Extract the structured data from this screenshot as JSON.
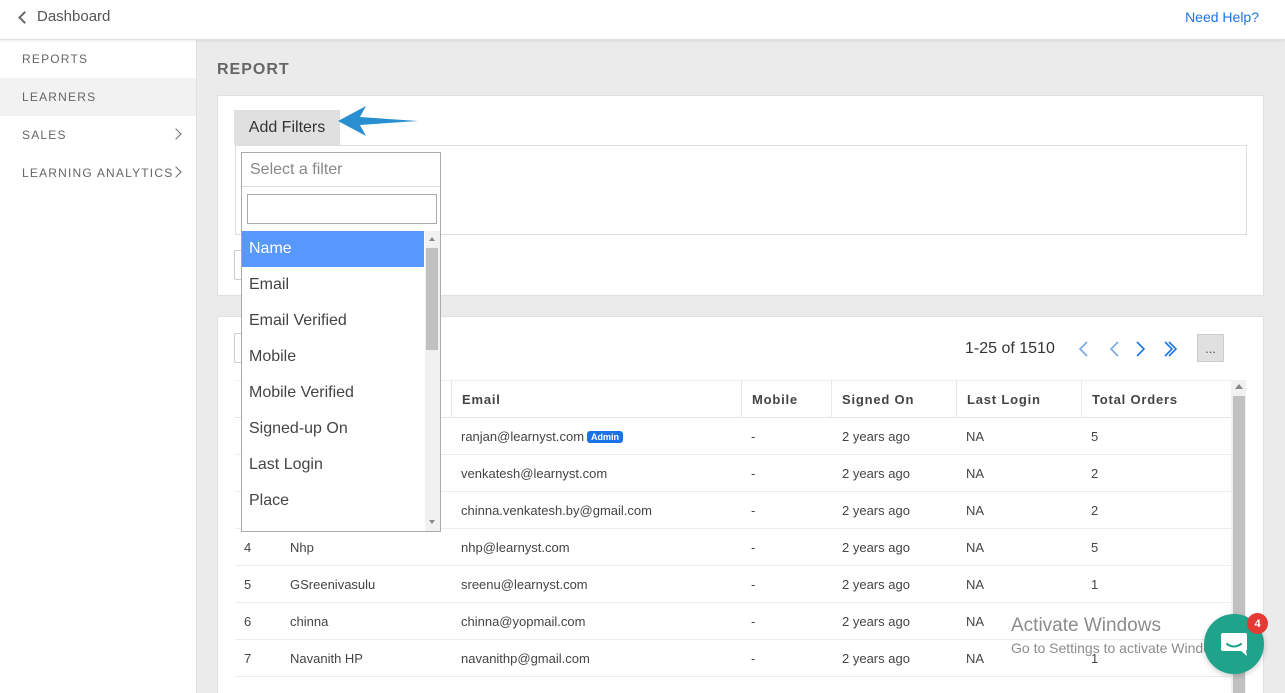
{
  "topbar": {
    "back_label": "Dashboard",
    "help_label": "Need Help?"
  },
  "sidebar": {
    "items": [
      {
        "label": "REPORTS",
        "has_arrow": false
      },
      {
        "label": "LEARNERS",
        "has_arrow": false,
        "active": true
      },
      {
        "label": "SALES",
        "has_arrow": true
      },
      {
        "label": "LEARNING ANALYTICS",
        "has_arrow": true
      }
    ]
  },
  "page": {
    "title": "REPORT"
  },
  "filters": {
    "add_label": "Add Filters"
  },
  "dropdown": {
    "placeholder": "Select a filter",
    "search_value": "",
    "options": [
      "Name",
      "Email",
      "Email Verified",
      "Mobile",
      "Mobile Verified",
      "Signed-up On",
      "Last Login",
      "Place"
    ],
    "selected": "Name"
  },
  "pagination": {
    "text": "1-25 of 1510",
    "more_label": "..."
  },
  "table": {
    "columns": [
      "Email",
      "Mobile",
      "Signed On",
      "Last Login",
      "Total Orders"
    ],
    "rows": [
      {
        "no": "",
        "name": "",
        "email": "ranjan@learnyst.com",
        "badge": "Admin",
        "mobile": "-",
        "signed": "2 years ago",
        "last": "NA",
        "orders": "5"
      },
      {
        "no": "",
        "name": "",
        "email": "venkatesh@learnyst.com",
        "badge": "",
        "mobile": "-",
        "signed": "2 years ago",
        "last": "NA",
        "orders": "2"
      },
      {
        "no": "",
        "name": "",
        "email": "chinna.venkatesh.by@gmail.com",
        "badge": "",
        "mobile": "-",
        "signed": "2 years ago",
        "last": "NA",
        "orders": "2"
      },
      {
        "no": "4",
        "name": "Nhp",
        "email": "nhp@learnyst.com",
        "badge": "",
        "mobile": "-",
        "signed": "2 years ago",
        "last": "NA",
        "orders": "5"
      },
      {
        "no": "5",
        "name": "GSreenivasulu",
        "email": "sreenu@learnyst.com",
        "badge": "",
        "mobile": "-",
        "signed": "2 years ago",
        "last": "NA",
        "orders": "1"
      },
      {
        "no": "6",
        "name": "chinna",
        "email": "chinna@yopmail.com",
        "badge": "",
        "mobile": "-",
        "signed": "2 years ago",
        "last": "NA",
        "orders": ""
      },
      {
        "no": "7",
        "name": "Navanith HP",
        "email": "navanithp@gmail.com",
        "badge": "",
        "mobile": "-",
        "signed": "2 years ago",
        "last": "NA",
        "orders": "1"
      }
    ]
  },
  "watermark": {
    "title": "Activate Windows",
    "subtitle": "Go to Settings to activate Windows."
  },
  "chat": {
    "badge_count": "4"
  },
  "colors": {
    "link": "#1a73e8",
    "selected": "#5897fb",
    "chat": "#1fa38a",
    "badge": "#e53935",
    "arrow": "#2a8fd0"
  }
}
